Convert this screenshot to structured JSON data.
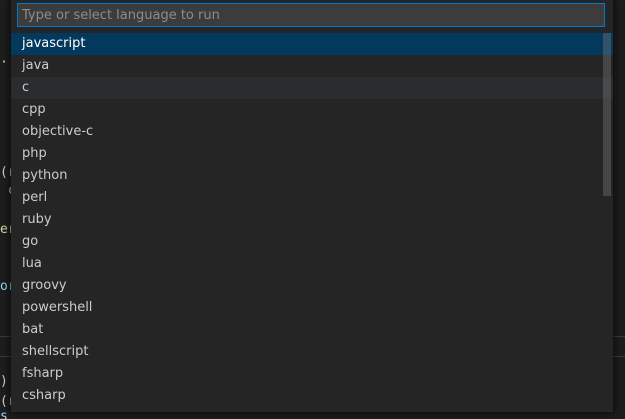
{
  "quick_pick": {
    "placeholder": "Type or select language to run",
    "value": "",
    "items": [
      {
        "label": "javascript",
        "state": "selected"
      },
      {
        "label": "java",
        "state": ""
      },
      {
        "label": "c",
        "state": "hovered"
      },
      {
        "label": "cpp",
        "state": ""
      },
      {
        "label": "objective-c",
        "state": ""
      },
      {
        "label": "php",
        "state": ""
      },
      {
        "label": "python",
        "state": ""
      },
      {
        "label": "perl",
        "state": ""
      },
      {
        "label": "ruby",
        "state": ""
      },
      {
        "label": "go",
        "state": ""
      },
      {
        "label": "lua",
        "state": ""
      },
      {
        "label": "groovy",
        "state": ""
      },
      {
        "label": "powershell",
        "state": ""
      },
      {
        "label": "bat",
        "state": ""
      },
      {
        "label": "shellscript",
        "state": ""
      },
      {
        "label": "fsharp",
        "state": ""
      },
      {
        "label": "csharp",
        "state": ""
      }
    ]
  },
  "background_editor": {
    "fragments": [
      {
        "text": "·",
        "color": "#d4d4d4"
      },
      {
        "text": "(r",
        "color": "#d4d4d4"
      },
      {
        "text": " c",
        "color": "#9cdcfe"
      },
      {
        "text": "er",
        "color": "#dcdcaa"
      },
      {
        "text": "or",
        "color": "#9cdcfe"
      },
      {
        "text": ")",
        "color": "#d4d4d4"
      },
      {
        "text": "(r",
        "color": "#d4d4d4"
      },
      {
        "text": "s",
        "color": "#9cdcfe"
      }
    ]
  }
}
